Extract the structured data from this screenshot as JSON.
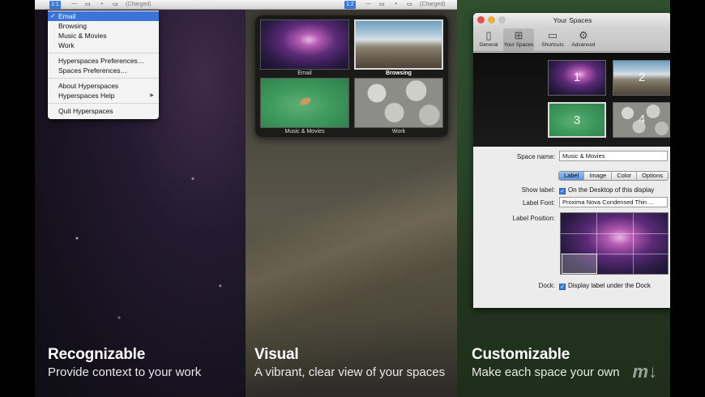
{
  "menubar": {
    "space_indicator_1": "1:1",
    "space_indicator_2": "1:2",
    "battery": "(Charged)"
  },
  "menu": {
    "spaces": [
      {
        "label": "Email",
        "checked": true
      },
      {
        "label": "Browsing",
        "checked": false
      },
      {
        "label": "Music & Movies",
        "checked": false
      },
      {
        "label": "Work",
        "checked": false
      }
    ],
    "prefs": [
      "Hyperspaces Preferences…",
      "Spaces Preferences…"
    ],
    "about": "About Hyperspaces",
    "help": "Hyperspaces Help",
    "quit": "Quit Hyperspaces"
  },
  "grid": {
    "cells": [
      {
        "label": "Email",
        "selected": false
      },
      {
        "label": "Browsing",
        "selected": true
      },
      {
        "label": "Music & Movies",
        "selected": false
      },
      {
        "label": "Work",
        "selected": false
      }
    ]
  },
  "window": {
    "title": "Your Spaces",
    "toolbar": [
      {
        "label": "General",
        "icon": "general-icon"
      },
      {
        "label": "Your Spaces",
        "icon": "your-spaces-icon"
      },
      {
        "label": "Shortcuts",
        "icon": "shortcuts-icon"
      },
      {
        "label": "Advanced",
        "icon": "gear-icon"
      }
    ],
    "preview_numbers": [
      "1",
      "2",
      "3",
      "4"
    ],
    "space_name_label": "Space name:",
    "space_name_value": "Music & Movies",
    "tabs": [
      "Label",
      "Image",
      "Color",
      "Options"
    ],
    "active_tab": "Label",
    "show_label_label": "Show label:",
    "show_label_check": "On the Desktop of this display",
    "label_font_label": "Label Font:",
    "label_font_value": "Proxima Nova Condensed Thin ...",
    "label_position_label": "Label Position:",
    "dock_label": "Dock:",
    "dock_check": "Display label under the Dock"
  },
  "captions": [
    {
      "title": "Recognizable",
      "subtitle": "Provide context to your work"
    },
    {
      "title": "Visual",
      "subtitle": "A vibrant, clear view of your spaces"
    },
    {
      "title": "Customizable",
      "subtitle": "Make each space your own"
    }
  ],
  "logo": "m↓"
}
